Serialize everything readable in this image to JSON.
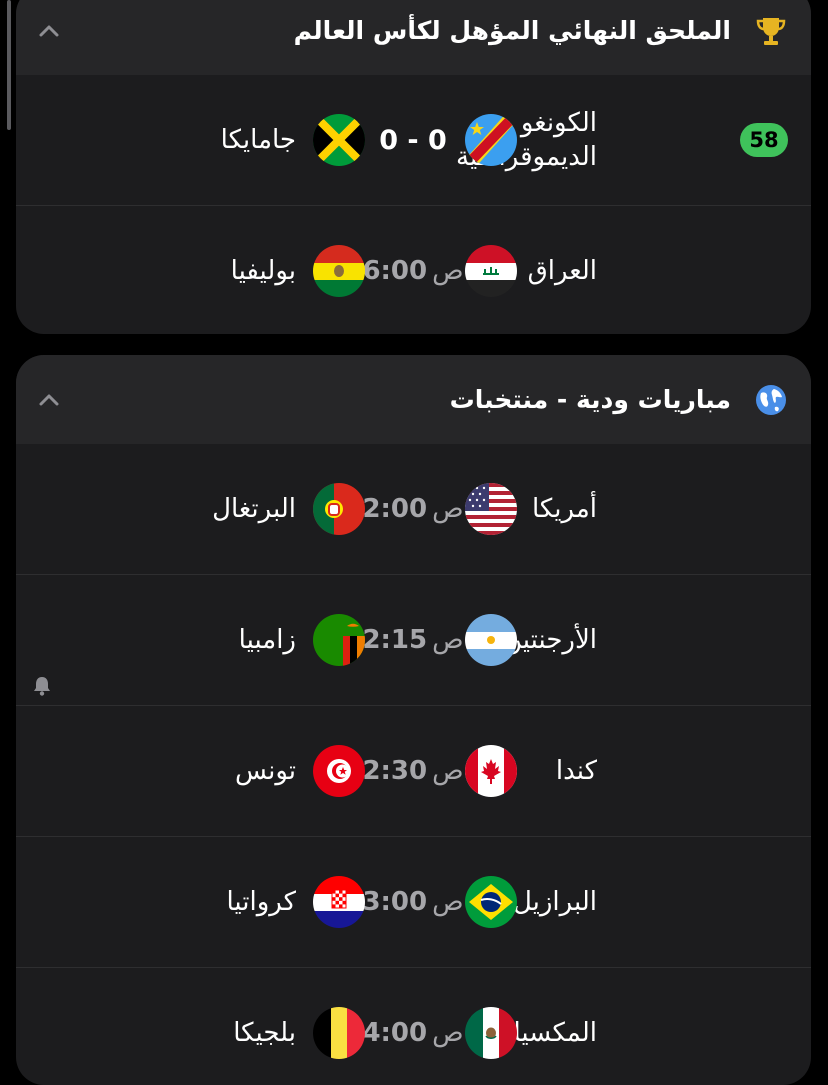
{
  "sections": [
    {
      "title": "الملحق النهائي المؤهل لكأس العالم",
      "icon": "trophy-icon",
      "matches": [
        {
          "home_line1": "الكونغو",
          "home_line2": "الديموقراطية",
          "home_flag": "dr-congo-flag-icon",
          "away": "جامايكا",
          "away_flag": "jamaica-flag-icon",
          "score": "0 - 0",
          "minute": "58"
        },
        {
          "home": "العراق",
          "home_flag": "iraq-flag-icon",
          "away": "بوليفيا",
          "away_flag": "bolivia-flag-icon",
          "time": "6:00",
          "ampm": "ص"
        }
      ]
    },
    {
      "title": "مباريات ودية - منتخبات",
      "icon": "globe-icon",
      "matches": [
        {
          "home": "أمريكا",
          "home_flag": "usa-flag-icon",
          "away": "البرتغال",
          "away_flag": "portugal-flag-icon",
          "time": "2:00",
          "ampm": "ص"
        },
        {
          "home": "الأرجنتين",
          "home_flag": "argentina-flag-icon",
          "away": "زامبيا",
          "away_flag": "zambia-flag-icon",
          "time": "2:15",
          "ampm": "ص"
        },
        {
          "home": "كندا",
          "home_flag": "canada-flag-icon",
          "away": "تونس",
          "away_flag": "tunisia-flag-icon",
          "time": "2:30",
          "ampm": "ص"
        },
        {
          "home": "البرازيل",
          "home_flag": "brazil-flag-icon",
          "away": "كرواتيا",
          "away_flag": "croatia-flag-icon",
          "time": "3:00",
          "ampm": "ص"
        },
        {
          "home": "المكسيك",
          "home_flag": "mexico-flag-icon",
          "away": "بلجيكا",
          "away_flag": "belgium-flag-icon",
          "time": "4:00",
          "ampm": "ص"
        }
      ]
    }
  ],
  "colors": {
    "background": "#000000",
    "card": "#1c1c1e",
    "card_header": "#262628",
    "live_badge": "#3fc25b",
    "time_text": "#a6a6aa"
  }
}
